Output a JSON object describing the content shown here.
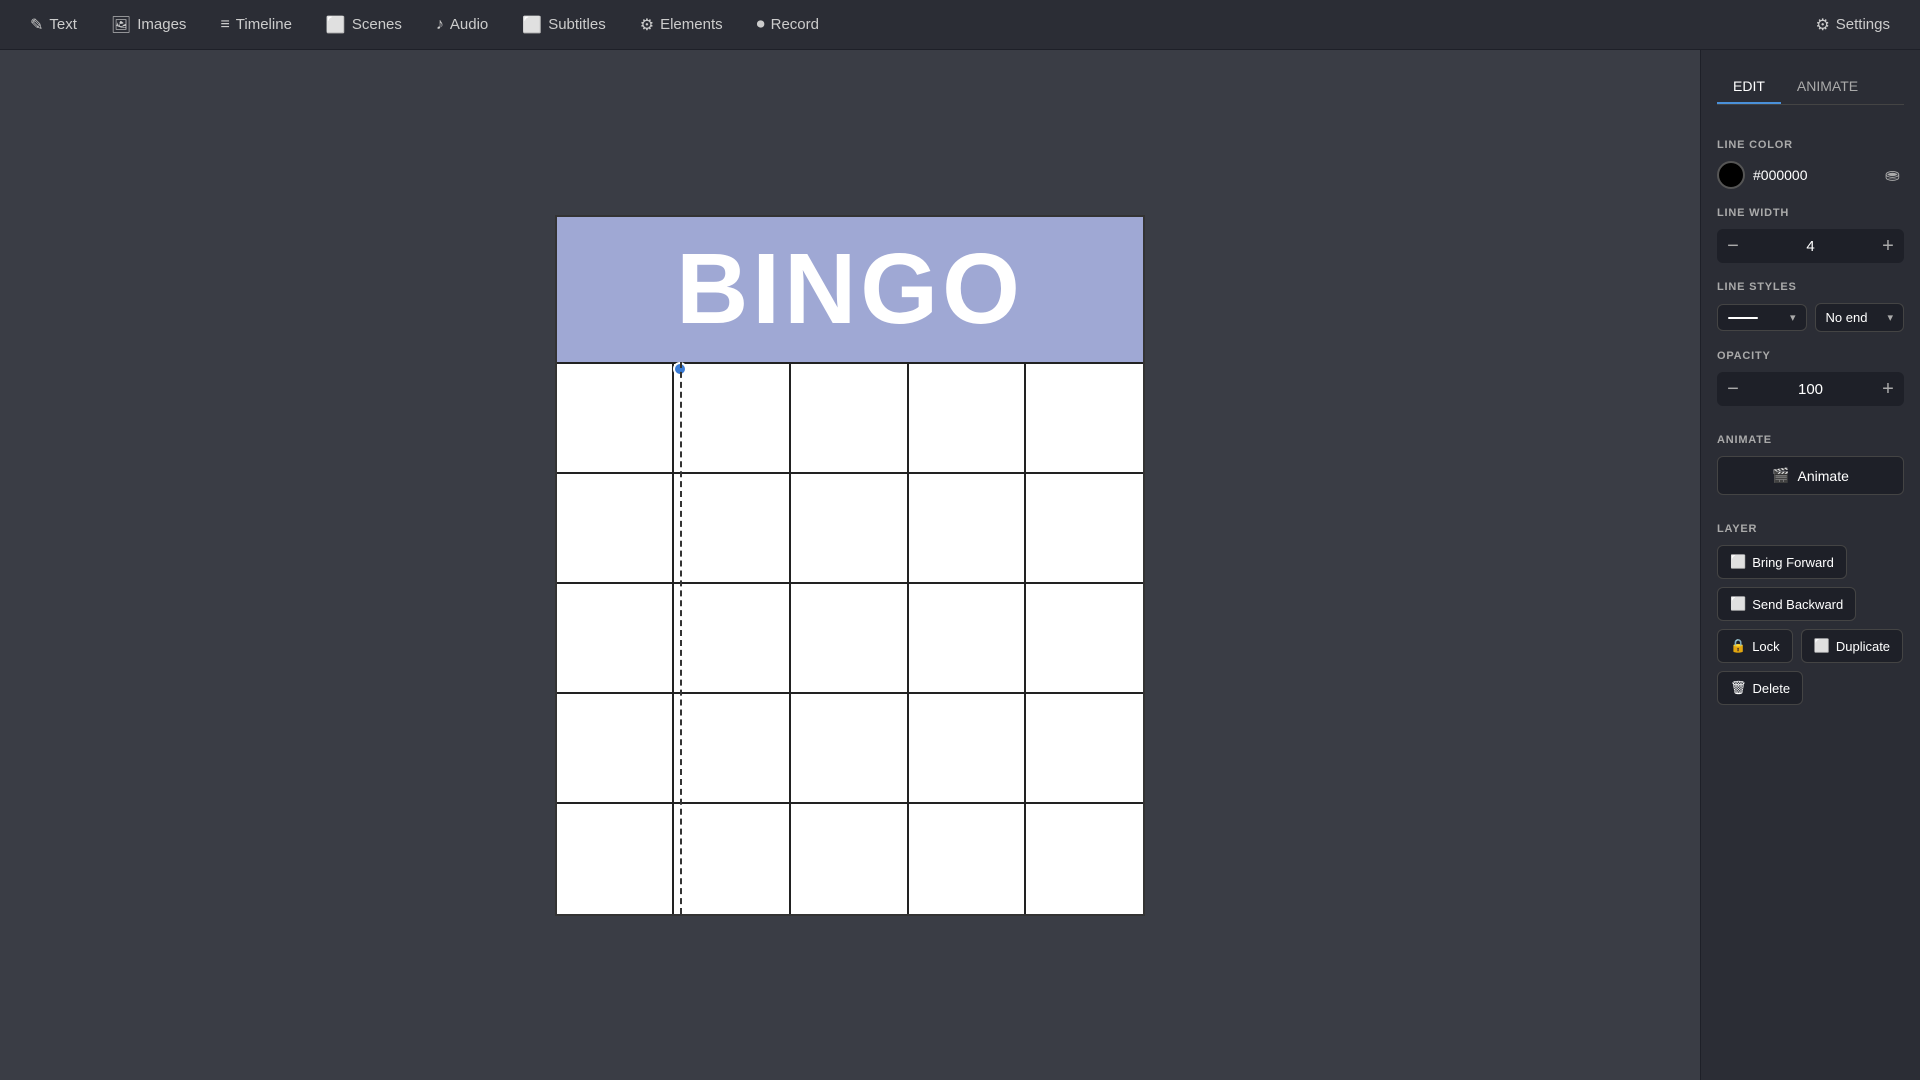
{
  "nav": {
    "items": [
      {
        "id": "text",
        "label": "Text",
        "icon": "✎"
      },
      {
        "id": "images",
        "label": "Images",
        "icon": "🖼"
      },
      {
        "id": "timeline",
        "label": "Timeline",
        "icon": "≡"
      },
      {
        "id": "scenes",
        "label": "Scenes",
        "icon": "⬜"
      },
      {
        "id": "audio",
        "label": "Audio",
        "icon": "♪"
      },
      {
        "id": "subtitles",
        "label": "Subtitles",
        "icon": "⬜"
      },
      {
        "id": "elements",
        "label": "Elements",
        "icon": "⚙"
      },
      {
        "id": "record",
        "label": "Record",
        "icon": "⏺"
      }
    ],
    "settings_label": "Settings"
  },
  "bingo": {
    "title": "BINGO",
    "header_color": "#9fa8d4",
    "grid_cols": 5,
    "grid_rows": 5
  },
  "panel": {
    "tabs": [
      {
        "id": "edit",
        "label": "EDIT",
        "active": true
      },
      {
        "id": "animate",
        "label": "ANIMATE",
        "active": false
      }
    ],
    "line_color": {
      "label": "LINE COLOR",
      "hex": "#000000"
    },
    "line_width": {
      "label": "LINE WIDTH",
      "value": "4"
    },
    "line_styles": {
      "label": "LINE STYLES",
      "style_option": "——",
      "end_option": "No end"
    },
    "opacity": {
      "label": "OPACITY",
      "value": "100"
    },
    "animate_section": {
      "label": "ANIMATE",
      "button_label": "Animate"
    },
    "layer": {
      "label": "LAYER",
      "bring_forward": "Bring Forward",
      "send_backward": "Send Backward",
      "lock": "Lock",
      "duplicate": "Duplicate",
      "delete": "Delete"
    }
  }
}
